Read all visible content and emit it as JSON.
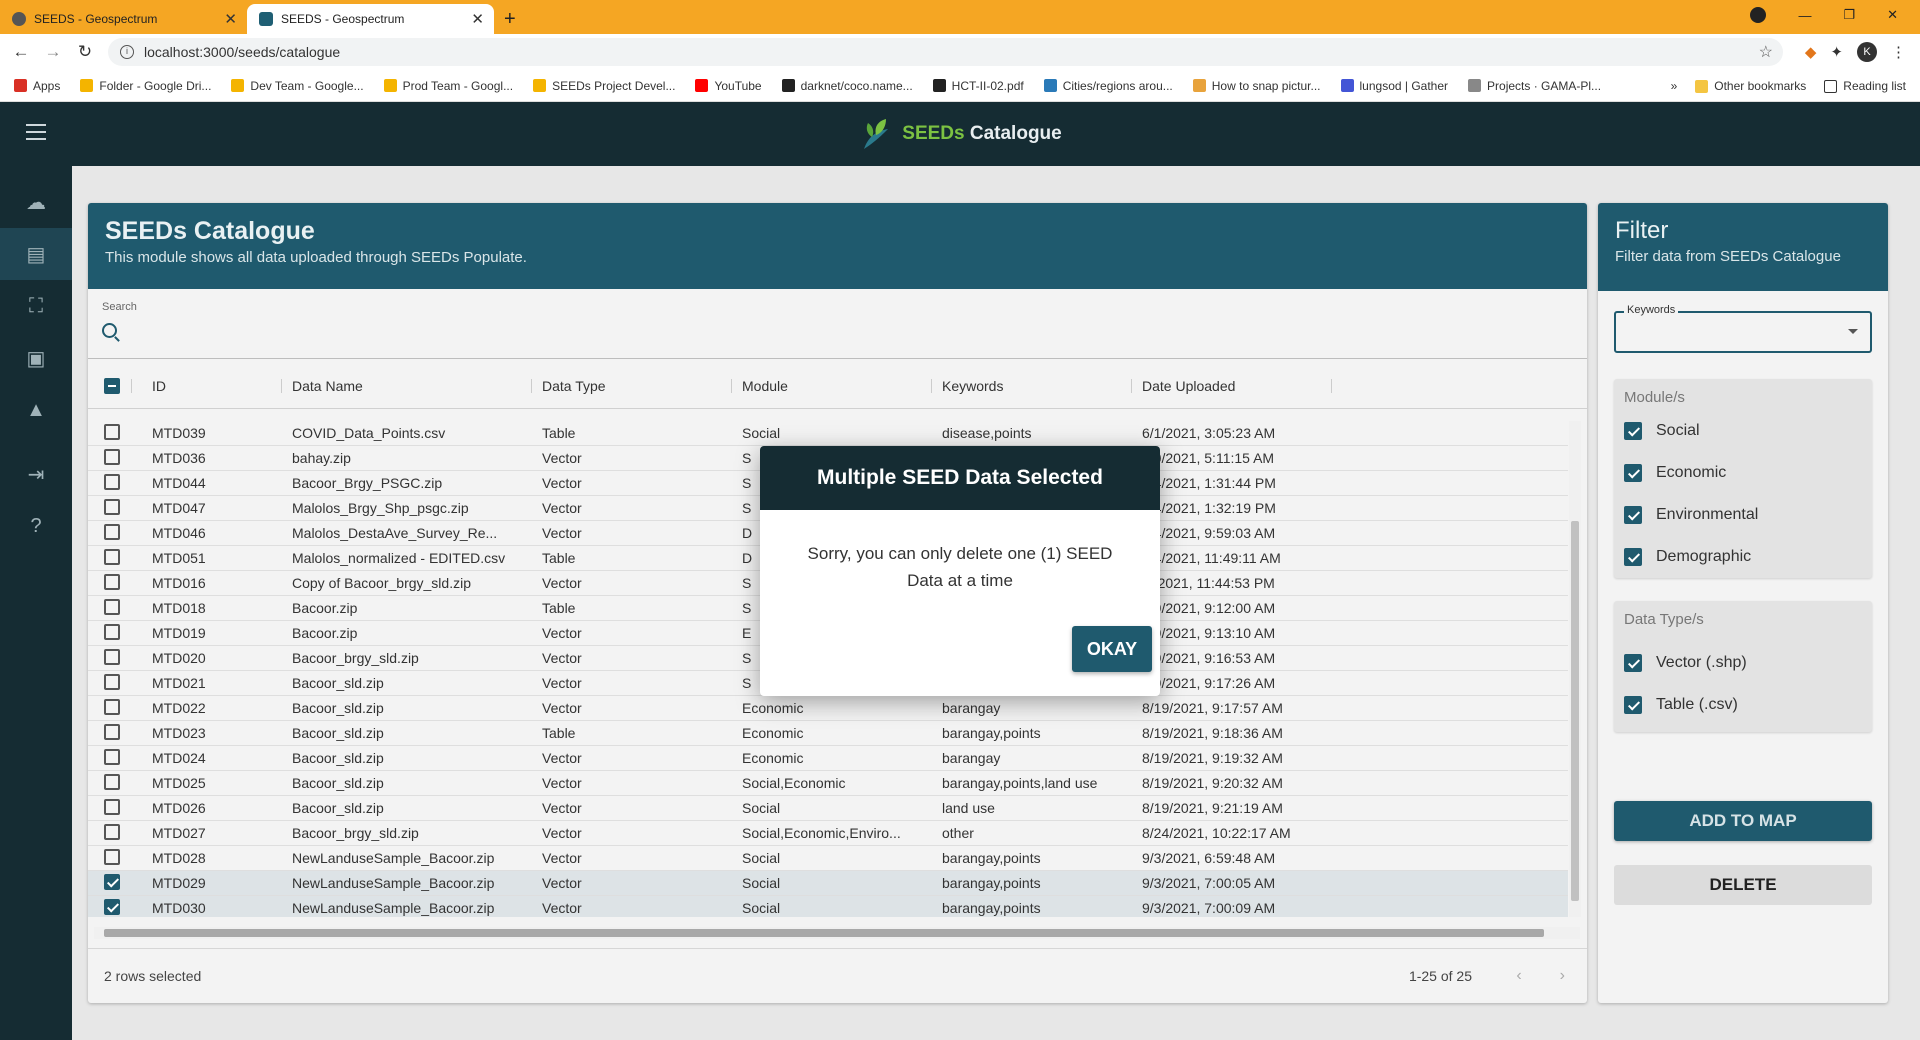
{
  "browser": {
    "tabs": [
      {
        "title": "SEEDS - Geospectrum"
      },
      {
        "title": "SEEDS - Geospectrum"
      }
    ],
    "url": "localhost:3000/seeds/catalogue",
    "bookmarks": [
      {
        "label": "Apps",
        "color": "#d93025"
      },
      {
        "label": "Folder - Google Dri...",
        "color": "#f4b400"
      },
      {
        "label": "Dev Team - Google...",
        "color": "#f4b400"
      },
      {
        "label": "Prod Team - Googl...",
        "color": "#f4b400"
      },
      {
        "label": "SEEDs Project Devel...",
        "color": "#f4b400"
      },
      {
        "label": "YouTube",
        "color": "#ff0000"
      },
      {
        "label": "darknet/coco.name...",
        "color": "#222222"
      },
      {
        "label": "HCT-II-02.pdf",
        "color": "#222222"
      },
      {
        "label": "Cities/regions arou...",
        "color": "#2a7ab8"
      },
      {
        "label": "How to snap pictur...",
        "color": "#e8a33c"
      },
      {
        "label": "lungsod | Gather",
        "color": "#4355d6"
      },
      {
        "label": "Projects · GAMA-Pl...",
        "color": "#888888"
      }
    ],
    "other_bookmarks": "Other bookmarks",
    "reading_list": "Reading list",
    "profile_initial": "K"
  },
  "app": {
    "brand_prefix": "SEEDs",
    "brand_suffix": " Catalogue",
    "sidebar_icons": [
      "upload-icon",
      "catalogue-icon",
      "map-icon",
      "dashboard-icon",
      "analytics-icon",
      "logout-icon",
      "help-icon"
    ]
  },
  "catalogue": {
    "title": "SEEDs Catalogue",
    "subtitle": "This module shows all data uploaded through SEEDs Populate.",
    "search_label": "Search",
    "columns": [
      "ID",
      "Data Name",
      "Data Type",
      "Module",
      "Keywords",
      "Date Uploaded"
    ],
    "rows": [
      {
        "id": "MTD039",
        "name": "COVID_Data_Points.csv",
        "type": "Table",
        "module": "Social",
        "keywords": "disease,points",
        "date": "6/1/2021, 3:05:23 AM",
        "checked": false
      },
      {
        "id": "MTD036",
        "name": "bahay.zip",
        "type": "Vector",
        "module": "S",
        "keywords": "",
        "date": "/10/2021, 5:11:15 AM",
        "checked": false
      },
      {
        "id": "MTD044",
        "name": "Bacoor_Brgy_PSGC.zip",
        "type": "Vector",
        "module": "S",
        "keywords": "",
        "date": "/14/2021, 1:31:44 PM",
        "checked": false
      },
      {
        "id": "MTD047",
        "name": "Malolos_Brgy_Shp_psgc.zip",
        "type": "Vector",
        "module": "S",
        "keywords": "",
        "date": "/14/2021, 1:32:19 PM",
        "checked": false
      },
      {
        "id": "MTD046",
        "name": "Malolos_DestaAve_Survey_Re...",
        "type": "Vector",
        "module": "D",
        "keywords": "",
        "date": "/24/2021, 9:59:03 AM",
        "checked": false
      },
      {
        "id": "MTD051",
        "name": "Malolos_normalized - EDITED.csv",
        "type": "Table",
        "module": "D",
        "keywords": "",
        "date": "/24/2021, 11:49:11 AM",
        "checked": false
      },
      {
        "id": "MTD016",
        "name": "Copy of Bacoor_brgy_sld.zip",
        "type": "Vector",
        "module": "S",
        "keywords": "",
        "date": "/5/2021, 11:44:53 PM",
        "checked": false
      },
      {
        "id": "MTD018",
        "name": "Bacoor.zip",
        "type": "Table",
        "module": "S",
        "keywords": "",
        "date": "/19/2021, 9:12:00 AM",
        "checked": false
      },
      {
        "id": "MTD019",
        "name": "Bacoor.zip",
        "type": "Vector",
        "module": "E",
        "keywords": "",
        "date": "/19/2021, 9:13:10 AM",
        "checked": false
      },
      {
        "id": "MTD020",
        "name": "Bacoor_brgy_sld.zip",
        "type": "Vector",
        "module": "S",
        "keywords": "",
        "date": "/19/2021, 9:16:53 AM",
        "checked": false
      },
      {
        "id": "MTD021",
        "name": "Bacoor_sld.zip",
        "type": "Vector",
        "module": "S",
        "keywords": "",
        "date": "/19/2021, 9:17:26 AM",
        "checked": false
      },
      {
        "id": "MTD022",
        "name": "Bacoor_sld.zip",
        "type": "Vector",
        "module": "Economic",
        "keywords": "barangay",
        "date": "8/19/2021, 9:17:57 AM",
        "checked": false
      },
      {
        "id": "MTD023",
        "name": "Bacoor_sld.zip",
        "type": "Table",
        "module": "Economic",
        "keywords": "barangay,points",
        "date": "8/19/2021, 9:18:36 AM",
        "checked": false
      },
      {
        "id": "MTD024",
        "name": "Bacoor_sld.zip",
        "type": "Vector",
        "module": "Economic",
        "keywords": "barangay",
        "date": "8/19/2021, 9:19:32 AM",
        "checked": false
      },
      {
        "id": "MTD025",
        "name": "Bacoor_sld.zip",
        "type": "Vector",
        "module": "Social,Economic",
        "keywords": "barangay,points,land use",
        "date": "8/19/2021, 9:20:32 AM",
        "checked": false
      },
      {
        "id": "MTD026",
        "name": "Bacoor_sld.zip",
        "type": "Vector",
        "module": "Social",
        "keywords": "land use",
        "date": "8/19/2021, 9:21:19 AM",
        "checked": false
      },
      {
        "id": "MTD027",
        "name": "Bacoor_brgy_sld.zip",
        "type": "Vector",
        "module": "Social,Economic,Enviro...",
        "keywords": "other",
        "date": "8/24/2021, 10:22:17 AM",
        "checked": false
      },
      {
        "id": "MTD028",
        "name": "NewLanduseSample_Bacoor.zip",
        "type": "Vector",
        "module": "Social",
        "keywords": "barangay,points",
        "date": "9/3/2021, 6:59:48 AM",
        "checked": false
      },
      {
        "id": "MTD029",
        "name": "NewLanduseSample_Bacoor.zip",
        "type": "Vector",
        "module": "Social",
        "keywords": "barangay,points",
        "date": "9/3/2021, 7:00:05 AM",
        "checked": true
      },
      {
        "id": "MTD030",
        "name": "NewLanduseSample_Bacoor.zip",
        "type": "Vector",
        "module": "Social",
        "keywords": "barangay,points",
        "date": "9/3/2021, 7:00:09 AM",
        "checked": true
      }
    ],
    "rows_selected": "2 rows selected",
    "pagination": "1-25 of 25"
  },
  "filter": {
    "title": "Filter",
    "subtitle": "Filter data from SEEDs Catalogue",
    "keywords_label": "Keywords",
    "modules_title": "Module/s",
    "modules": [
      {
        "label": "Social",
        "checked": true
      },
      {
        "label": "Economic",
        "checked": true
      },
      {
        "label": "Environmental",
        "checked": true
      },
      {
        "label": "Demographic",
        "checked": true
      }
    ],
    "types_title": "Data Type/s",
    "types": [
      {
        "label": "Vector (.shp)",
        "checked": true
      },
      {
        "label": "Table (.csv)",
        "checked": true
      }
    ],
    "add_to_map": "ADD TO MAP",
    "delete": "DELETE"
  },
  "dialog": {
    "title": "Multiple SEED Data Selected",
    "message": "Sorry, you can only delete one (1) SEED Data at a time",
    "ok": "OKAY"
  },
  "colors": {
    "primary": "#1f5a6e",
    "dark": "#152c33",
    "browser_frame": "#f5a623",
    "brand_green": "#7cc242"
  }
}
